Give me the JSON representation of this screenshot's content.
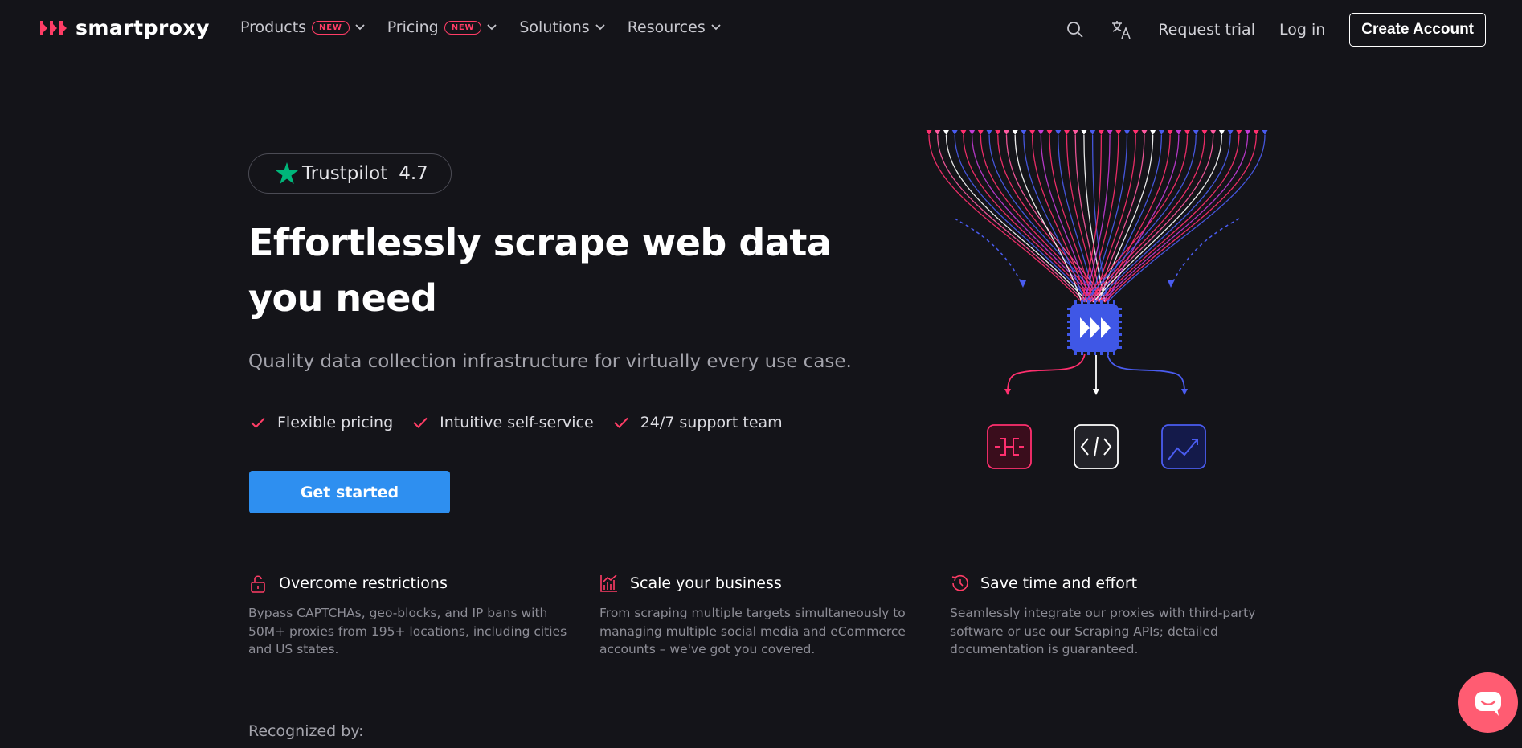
{
  "brand": {
    "name": "smartproxy",
    "accent": "#ff3d66",
    "primary_blue": "#2e8ff0"
  },
  "nav": {
    "menu": [
      {
        "label": "Products",
        "badge": "NEW"
      },
      {
        "label": "Pricing",
        "badge": "NEW"
      },
      {
        "label": "Solutions",
        "badge": ""
      },
      {
        "label": "Resources",
        "badge": ""
      }
    ],
    "request_trial": "Request trial",
    "login": "Log in",
    "create_account": "Create Account",
    "icons": [
      "search-icon",
      "translate-icon"
    ]
  },
  "hero": {
    "trustpilot": {
      "name": "Trustpilot",
      "score": "4.7",
      "star_color": "#00b67a"
    },
    "title": "Effortlessly scrape web data you need",
    "subtitle": "Quality data collection infrastructure for virtually every use case.",
    "checks": [
      "Flexible pricing",
      "Intuitive self-service",
      "24/7 support team"
    ],
    "cta": "Get started"
  },
  "features": [
    {
      "icon": "unlock-icon",
      "title": "Overcome restrictions",
      "body": "Bypass CAPTCHAs, geo-blocks, and IP bans with 50M+ proxies from 195+ locations, including cities and US states."
    },
    {
      "icon": "chart-icon",
      "title": "Scale your business",
      "body": "From scraping multiple targets simultaneously to managing multiple social media and eCommerce accounts – we've got you covered."
    },
    {
      "icon": "clock-icon",
      "title": "Save time and effort",
      "body": "Seamlessly integrate our proxies with third-party software or use our Scraping APIs; detailed documentation is guaranteed."
    }
  ],
  "recognized_label": "Recognized by:",
  "illustration": {
    "icons": [
      "plug-icon",
      "code-icon",
      "trend-chart-icon"
    ]
  }
}
